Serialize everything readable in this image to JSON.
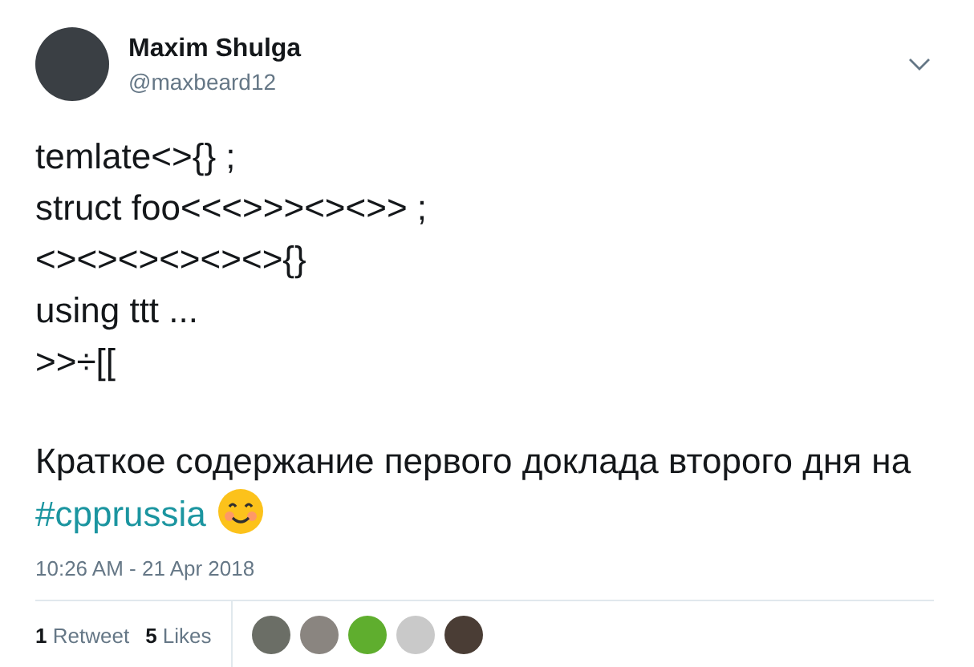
{
  "author": {
    "name": "Maxim Shulga",
    "handle": "@maxbeard12"
  },
  "code_lines": [
    "temlate<>{} ;",
    "struct foo<<<>>><><>> ;",
    "<><><><><><>{}",
    "using ttt ...",
    ">>÷[["
  ],
  "message": {
    "text": "Краткое содержание первого доклада второго дня на",
    "hashtag": "#cpprussia"
  },
  "timestamp": "10:26 AM - 21 Apr 2018",
  "stats": [
    {
      "count": "1",
      "label": "Retweet"
    },
    {
      "count": "5",
      "label": "Likes"
    }
  ]
}
